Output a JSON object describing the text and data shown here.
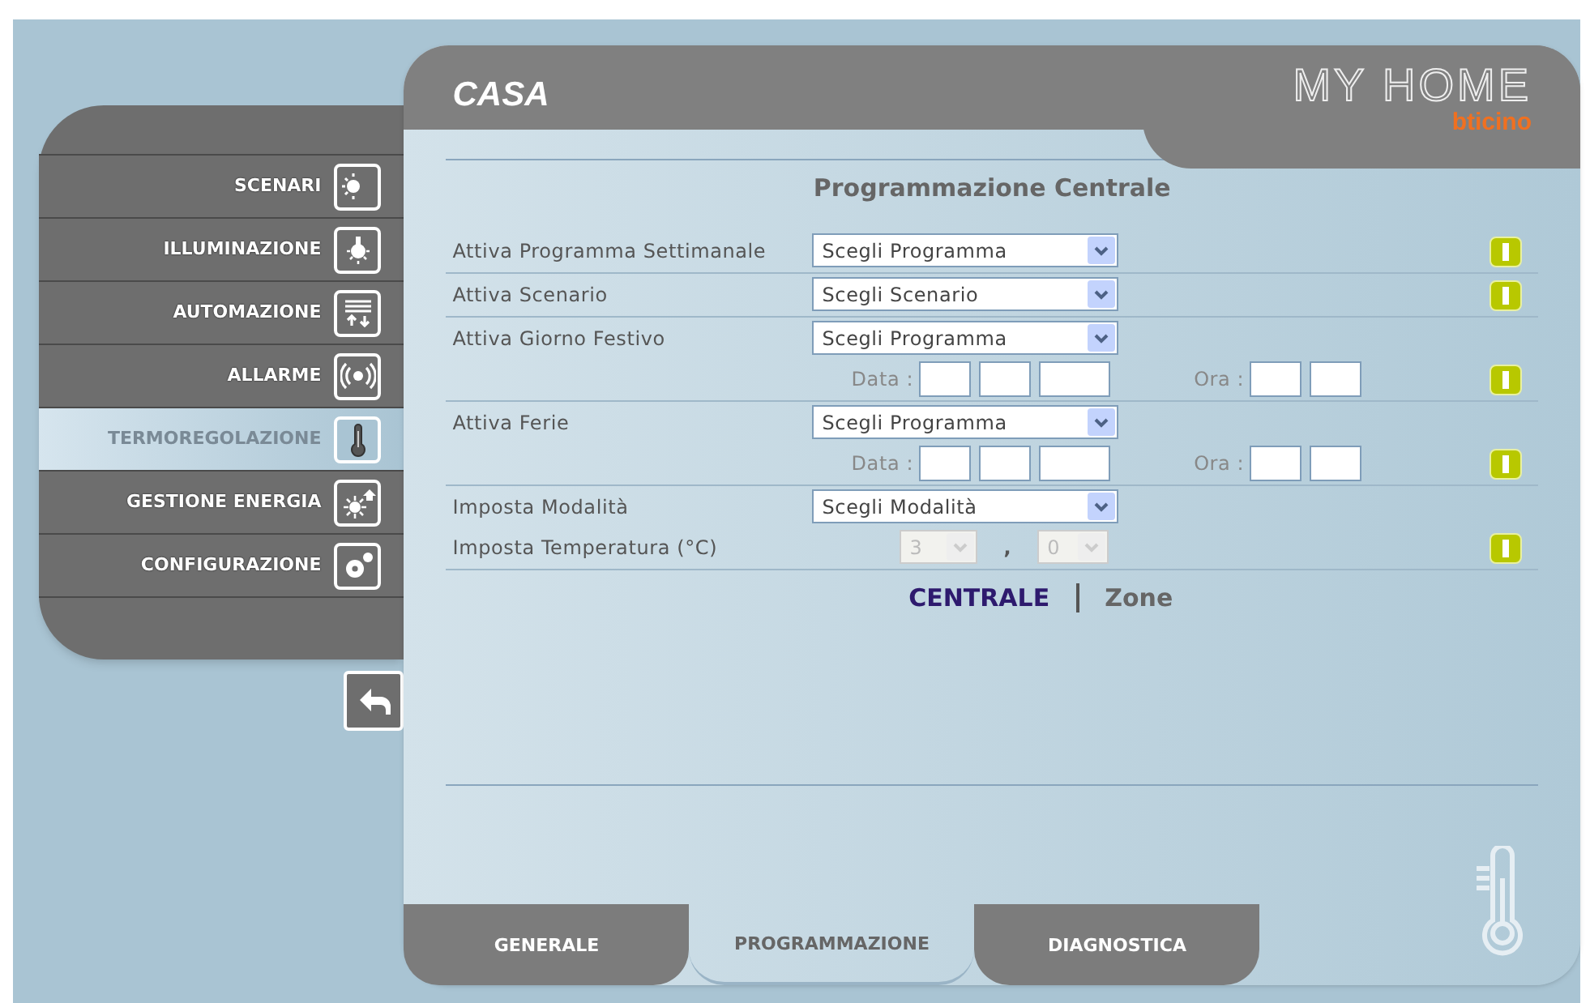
{
  "header": {
    "title": "CASA",
    "brand": "MY HOME",
    "logo": "bticino"
  },
  "sidebar": {
    "items": [
      {
        "label": "SCENARI",
        "kind": "scenes",
        "selected": false
      },
      {
        "label": "ILLUMINAZIONE",
        "kind": "bulb",
        "selected": false
      },
      {
        "label": "AUTOMAZIONE",
        "kind": "shutter",
        "selected": false
      },
      {
        "label": "ALLARME",
        "kind": "alarm",
        "selected": false
      },
      {
        "label": "TERMOREGOLAZIONE",
        "kind": "thermo",
        "selected": true
      },
      {
        "label": "GESTIONE ENERGIA",
        "kind": "energy",
        "selected": false
      },
      {
        "label": "CONFIGURAZIONE",
        "kind": "gears",
        "selected": false
      }
    ]
  },
  "page_title": "Programmazione Centrale",
  "sections": [
    {
      "toggle": true,
      "lines": [
        {
          "kind": "select",
          "label": "Attiva Programma Settimanale",
          "value": "Scegli Programma"
        }
      ]
    },
    {
      "toggle": true,
      "lines": [
        {
          "kind": "select",
          "label": "Attiva Scenario",
          "value": "Scegli Scenario"
        }
      ]
    },
    {
      "toggle": true,
      "lines": [
        {
          "kind": "select",
          "label": "Attiva Giorno Festivo",
          "value": "Scegli Programma"
        },
        {
          "kind": "datetime",
          "date_label": "Data :",
          "time_label": "Ora :"
        }
      ]
    },
    {
      "toggle": true,
      "lines": [
        {
          "kind": "select",
          "label": "Attiva Ferie",
          "value": "Scegli Programma"
        },
        {
          "kind": "datetime",
          "date_label": "Data :",
          "time_label": "Ora :"
        }
      ]
    },
    {
      "toggle": true,
      "lines": [
        {
          "kind": "select",
          "label": "Imposta Modalità",
          "value": "Scegli Modalità"
        },
        {
          "kind": "temperature",
          "label": "Imposta Temperatura (°C)",
          "integer": "3",
          "separator": ",",
          "decimal": "0",
          "disabled": true
        }
      ]
    }
  ],
  "links": [
    {
      "label": "CENTRALE",
      "selected": true
    },
    {
      "label": "Zone",
      "selected": false
    }
  ],
  "tabs": [
    {
      "label": "GENERALE",
      "selected": false
    },
    {
      "label": "PROGRAMMAZIONE",
      "selected": true
    },
    {
      "label": "DIAGNOSTICA",
      "selected": false
    }
  ]
}
